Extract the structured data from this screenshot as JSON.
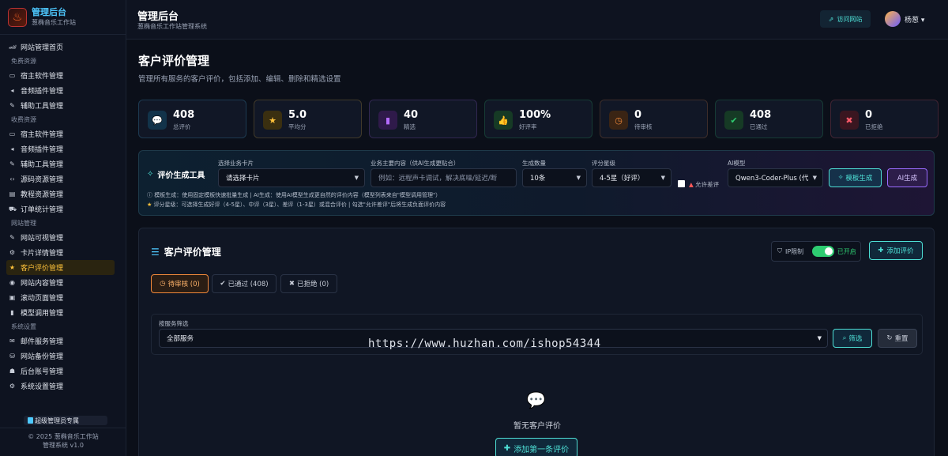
{
  "brand": {
    "title": "管理后台",
    "subtitle": "葱椭音乐工作站",
    "logo_icon": "flame-icon"
  },
  "sidebar": {
    "items": [
      {
        "type": "item",
        "icon": "🏎",
        "label": "网站管理首页"
      },
      {
        "type": "section",
        "label": "免费资源"
      },
      {
        "type": "item",
        "icon": "▭",
        "label": "宿主软件管理"
      },
      {
        "type": "item",
        "icon": "◂",
        "label": "音频插件管理"
      },
      {
        "type": "item",
        "icon": "✎",
        "label": "辅助工具管理"
      },
      {
        "type": "section",
        "label": "收费资源"
      },
      {
        "type": "item",
        "icon": "▭",
        "label": "宿主软件管理"
      },
      {
        "type": "item",
        "icon": "◂",
        "label": "音频插件管理"
      },
      {
        "type": "item",
        "icon": "✎",
        "label": "辅助工具管理"
      },
      {
        "type": "item",
        "icon": "‹›",
        "label": "源码资源管理"
      },
      {
        "type": "item",
        "icon": "▤",
        "label": "教程资源管理"
      },
      {
        "type": "item",
        "icon": "⛟",
        "label": "订单统计管理"
      },
      {
        "type": "section",
        "label": "网站管理"
      },
      {
        "type": "item",
        "icon": "✎",
        "label": "网站可视管理"
      },
      {
        "type": "item",
        "icon": "⚙",
        "label": "卡片详情管理"
      },
      {
        "type": "item",
        "icon": "★",
        "label": "客户评价管理",
        "active": true
      },
      {
        "type": "item",
        "icon": "◉",
        "label": "网站内容管理"
      },
      {
        "type": "item",
        "icon": "▣",
        "label": "滚动页面管理"
      },
      {
        "type": "item",
        "icon": "▮",
        "label": "模型调用管理"
      },
      {
        "type": "section",
        "label": "系统设置"
      },
      {
        "type": "item",
        "icon": "✉",
        "label": "邮件服务管理"
      },
      {
        "type": "item",
        "icon": "⛁",
        "label": "网站备份管理"
      },
      {
        "type": "item",
        "icon": "☗",
        "label": "后台账号管理"
      },
      {
        "type": "item",
        "icon": "⚙",
        "label": "系统设置管理"
      }
    ],
    "user_badge": "超级管理员专属",
    "footer_line1": "© 2025 葱椭音乐工作站",
    "footer_line2": "管理系统 v1.0"
  },
  "topbar": {
    "title": "管理后台",
    "subtitle": "葱椭音乐工作站管理系统",
    "visit_label": "访问网站",
    "user_name": "杨葱"
  },
  "main": {
    "title": "客户评价管理",
    "description": "管理所有服务的客户评价，包括添加、编辑、删除和精选设置"
  },
  "stats": [
    {
      "value": "408",
      "label": "总评价",
      "icon": "comments-icon",
      "glyph": "💬",
      "color": "#4ec9ff",
      "bg": "#12334a"
    },
    {
      "value": "5.0",
      "label": "平均分",
      "icon": "star-icon",
      "glyph": "★",
      "color": "#ffc23a",
      "bg": "#3a2f10"
    },
    {
      "value": "40",
      "label": "精选",
      "icon": "bookmark-icon",
      "glyph": "▮",
      "color": "#b46bff",
      "bg": "#2f1a4a"
    },
    {
      "value": "100%",
      "label": "好评率",
      "icon": "thumbs-up-icon",
      "glyph": "👍",
      "color": "#2ecc71",
      "bg": "#163a25"
    },
    {
      "value": "0",
      "label": "待审核",
      "icon": "clock-icon",
      "glyph": "◷",
      "color": "#f0883a",
      "bg": "#3a2414"
    },
    {
      "value": "408",
      "label": "已通过",
      "icon": "check-circle-icon",
      "glyph": "✔",
      "color": "#2ecc71",
      "bg": "#163a25"
    },
    {
      "value": "0",
      "label": "已拒绝",
      "icon": "x-circle-icon",
      "glyph": "✖",
      "color": "#ff5a6a",
      "bg": "#3a1620"
    }
  ],
  "generator": {
    "title": "评价生成工具",
    "card_label": "选择业务卡片",
    "card_value": "请选择卡片",
    "content_label": "业务主要内容（供AI生成更贴合）",
    "content_placeholder": "例如：远程声卡调试，解决底噪/延迟/断",
    "count_label": "生成数量",
    "count_value": "10条",
    "rating_label": "评分星级",
    "rating_value": "4-5星（好评）",
    "allow_negative": "允许差评",
    "model_label": "AI模型",
    "model_value": "Qwen3-Coder-Plus (代",
    "template_btn": "模板生成",
    "ai_btn": "AI生成",
    "note1": "模板生成：使用固定模板快速批量生成 | AI生成：使用AI模型生成更自然的评价内容（模型列表来自\"模型调用管理\"）",
    "note2": "评分星级：可选择生成好评（4-5星）、中评（3星）、差评（1-3星）或混合评价 | 勾选\"允许差评\"后将生成负面评价内容"
  },
  "reviews": {
    "title": "客户评价管理",
    "ip_label": "IP限制",
    "ip_state": "已开启",
    "add_label": "添加评价",
    "tabs": [
      {
        "label": "待审核 (0)",
        "icon": "◷",
        "active": true
      },
      {
        "label": "已通过 (408)",
        "icon": "✔"
      },
      {
        "label": "已拒绝 (0)",
        "icon": "✖"
      }
    ],
    "filter_label": "按服务筛选",
    "filter_value": "全部服务",
    "filter_btn": "筛选",
    "reset_btn": "重置",
    "watermark": "https://www.huzhan.com/ishop54344",
    "empty_text": "暂无客户评价",
    "first_btn": "添加第一条评价"
  }
}
